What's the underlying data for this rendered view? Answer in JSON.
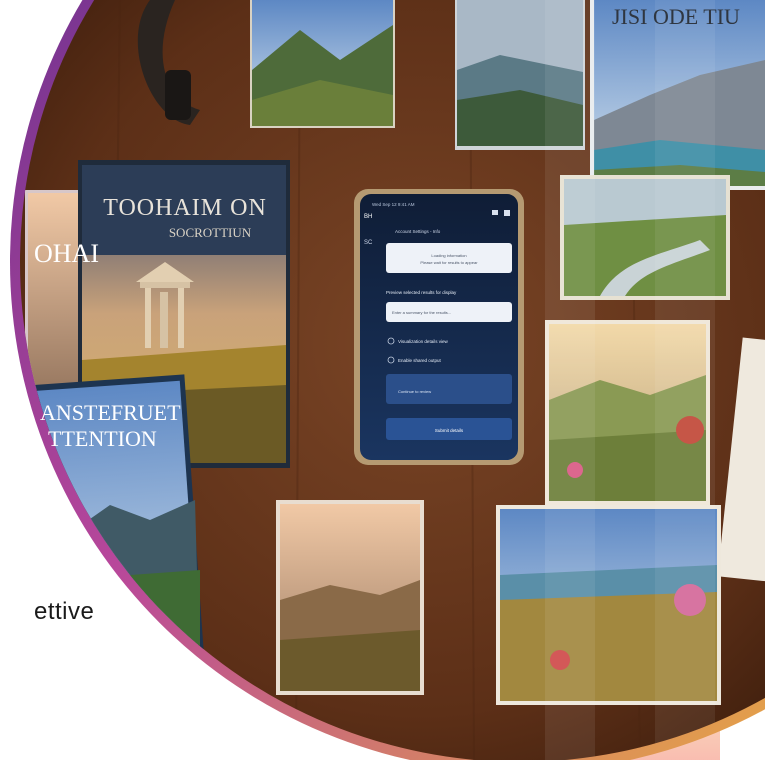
{
  "caption": "ettive",
  "books": {
    "left_top": {
      "title_line1": "TOOHAIM ON",
      "title_line2": "SOCROTTIUN"
    },
    "left_edge": {
      "title": "OHAI"
    },
    "left_bottom": {
      "title_line1": "ANSTEFRUET",
      "title_line2": "TTENTION"
    },
    "top_right": {
      "title": "JISI ODE TIU"
    }
  },
  "phone": {
    "status_left": "Wed Sep 12 9:41 AM",
    "header_left": "BH",
    "side_label": "SC",
    "account_line": "Account Settings - Info",
    "card_line1": "Loading information",
    "card_line2": "Please wait for results to appear",
    "section_label": "Preview selected results for display",
    "input_text": "Enter a summary for the results...",
    "toggle1_label": "Visualization details view",
    "toggle2_label": "Enable shared output",
    "primary_text": "Continue to review",
    "bottom_button": "Submit details"
  },
  "colors": {
    "arc_start": "#5b2c8c",
    "arc_mid": "#b8479b",
    "arc_end": "#f4c22a",
    "table": "#6e3a1e",
    "phone_bg": "#142848"
  }
}
